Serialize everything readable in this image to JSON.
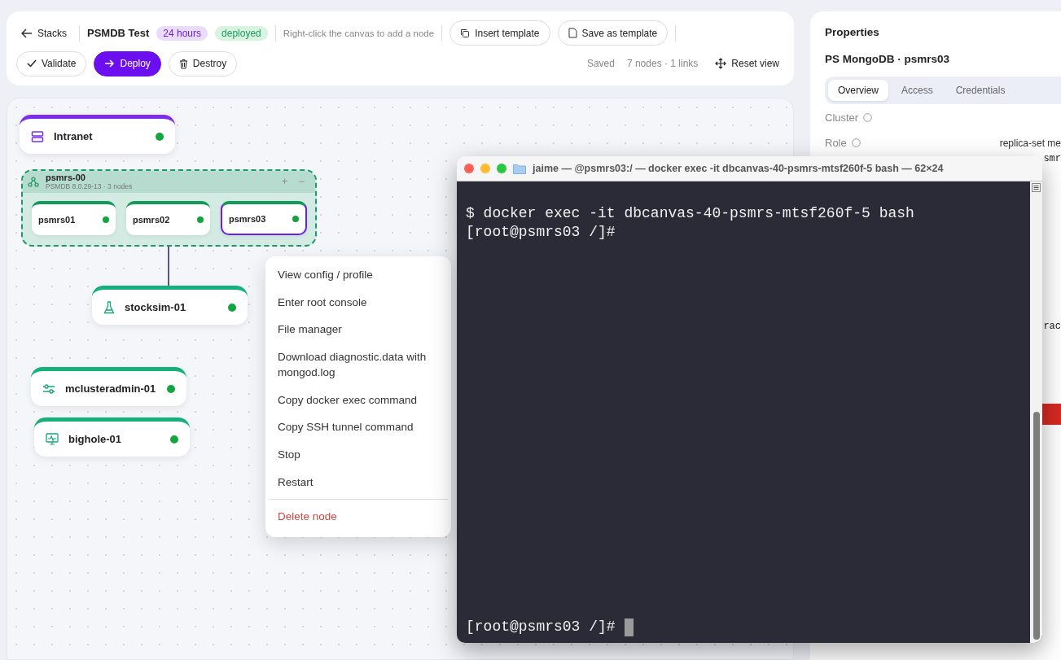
{
  "toolbar": {
    "back": "Stacks",
    "title": "PSMDB Test",
    "badges": [
      {
        "label": "24 hours",
        "kind": "ttl"
      },
      {
        "label": "deployed",
        "kind": "status"
      }
    ],
    "hint": "Right-click the canvas to add a node",
    "buttons": [
      {
        "label": "Insert template",
        "kind": "copy"
      },
      {
        "label": "Save as template",
        "kind": "file"
      }
    ],
    "actions": [
      {
        "label": "Validate",
        "kind": "check",
        "primary": false
      },
      {
        "label": "Deploy",
        "kind": "arrow",
        "primary": true
      },
      {
        "label": "Destroy",
        "kind": "trash",
        "primary": false
      }
    ],
    "save_state": "Saved",
    "counts": "7 nodes · 1 links",
    "reset": "Reset view"
  },
  "canvas": {
    "nodes": [
      {
        "name": "Intranet",
        "kind": "server",
        "color": "#7c2df0",
        "selected": false
      },
      {
        "name": "stocksim-01",
        "kind": "flask",
        "color": "#16b07a",
        "selected": false
      },
      {
        "name": "mclusteradmin-01",
        "kind": "sliders",
        "color": "#16b07a",
        "selected": false
      },
      {
        "name": "bighole-01",
        "kind": "monitor",
        "color": "#16b07a",
        "selected": false
      }
    ],
    "group": {
      "name": "psmrs-00",
      "meta": "PSMDB 8.0.29-13 · 3 nodes",
      "add": "+",
      "remove": "−",
      "members": [
        {
          "name": "psmrs01",
          "selected": false
        },
        {
          "name": "psmrs02",
          "selected": false
        },
        {
          "name": "psmrs03",
          "selected": true
        }
      ]
    }
  },
  "context_menu": {
    "items": [
      {
        "label": "View config / profile",
        "kind": "normal"
      },
      {
        "label": "Enter root console",
        "kind": "normal"
      },
      {
        "label": "File manager",
        "kind": "normal"
      },
      {
        "label": "Download diagnostic.data with mongod.log",
        "kind": "normal"
      },
      {
        "label": "Copy docker exec command",
        "kind": "normal"
      },
      {
        "label": "Copy SSH tunnel command",
        "kind": "normal"
      },
      {
        "label": "Stop",
        "kind": "normal"
      },
      {
        "label": "Restart",
        "kind": "normal"
      },
      {
        "label": "Delete node",
        "kind": "danger"
      }
    ]
  },
  "terminal": {
    "title": "jaime — @psmrs03:/ — docker exec -it dbcanvas-40-psmrs-mtsf260f-5 bash — 62×24",
    "lines": [
      "$ docker exec -it dbcanvas-40-psmrs-mtsf260f-5 bash",
      "[root@psmrs03 /]#"
    ],
    "prompt": "[root@psmrs03 /]#"
  },
  "properties": {
    "heading": "Properties",
    "subtitle": "PS MongoDB · psmrs03",
    "tabs": [
      {
        "label": "Overview",
        "selected": true
      },
      {
        "label": "Access",
        "selected": false
      },
      {
        "label": "Credentials",
        "selected": false
      }
    ],
    "fields": [
      {
        "label": "Cluster"
      },
      {
        "label": "Role",
        "value": "replica-set me"
      }
    ],
    "fragments": [
      "smr",
      "rac"
    ]
  }
}
